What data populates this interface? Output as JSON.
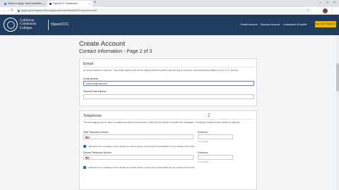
{
  "browser": {
    "tabs": [
      {
        "label": "Steps to Apply: New Institution"
      },
      {
        "label": "OpenCCC Production"
      }
    ],
    "url": "apply.opencccapply.net/cccapply-welcome?adobeMCID=openccc-mobi"
  },
  "header": {
    "college_name": [
      "California",
      "Community",
      "Colleges"
    ],
    "brand": "OpenCCC",
    "links": [
      "Create Account",
      "Recover Account",
      "Lookahead A2 publié"
    ],
    "button": "Sign In to OpenCCC"
  },
  "page": {
    "title": "Create Account",
    "subtitle": "Contact Information - Page 2 of 3"
  },
  "email": {
    "heading": "Email",
    "description": "An email address is required. Your email address will not be shared with third parties and will only be used for communications related to your CCC account.",
    "address_label": "Email Address",
    "address_value": "someone@mail.com",
    "repeat_label": "Repeat Email Address",
    "repeat_value": ""
  },
  "telephone": {
    "heading": "Telephone",
    "description": "The messaging may be used to contact you about your account. Check the box below to enable text messages. Providing a mobile phone number is optional.",
    "main_label": "Main Telephone Number",
    "main_country": "+1",
    "extension_label": "Extension",
    "extension_hint": "Up to 6 digits",
    "main_text_consent": "I authorize text messages to the telephone number above, and accept responsibility for any charges that result.",
    "second_label": "Second Telephone Number",
    "second_country": "+1",
    "extension2_label": "Extension",
    "extension2_hint": "Up to 6 digits",
    "second_text_consent": "I authorize text messages to the telephone number above, and accept responsibility for any charges that result."
  }
}
